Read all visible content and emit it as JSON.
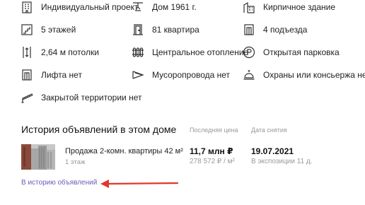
{
  "features": {
    "individual_project": {
      "label": "Индивидуальный проект",
      "icon": "building-icon"
    },
    "year": {
      "label": "Дом 1961 г.",
      "icon": "crane-icon"
    },
    "material": {
      "label": "Кирпичное здание",
      "icon": "brick-building-icon"
    },
    "floors": {
      "label": "5 этажей",
      "icon": "stairs-icon"
    },
    "flats": {
      "label": "81 квартира",
      "icon": "door-icon"
    },
    "entrances": {
      "label": "4 подъезда",
      "icon": "entrance-icon"
    },
    "ceilings": {
      "label": "2,64 м потолки",
      "icon": "ceiling-height-icon"
    },
    "heating": {
      "label": "Центральное отопление",
      "icon": "radiator-icon"
    },
    "parking": {
      "label": "Открытая парковка",
      "icon": "parking-icon"
    },
    "lift": {
      "label": "Лифта нет",
      "icon": "elevator-icon"
    },
    "garbage": {
      "label": "Мусоропровода нет",
      "icon": "garbage-chute-icon"
    },
    "concierge": {
      "label": "Охраны или консьержа нет",
      "icon": "concierge-bell-icon"
    },
    "closed_territory": {
      "label": "Закрытой территории нет",
      "icon": "barrier-icon"
    }
  },
  "history": {
    "title": "История объявлений в этом доме",
    "col_price": "Последняя цена",
    "col_date": "Дата снятия",
    "rows": [
      {
        "title": "Продажа 2-комн. квартиры 42 м²",
        "subtitle": "1 этаж",
        "price": "11,7 млн ₽",
        "price_per_m": "278 572 ₽ / м²",
        "date": "19.07.2021",
        "exposure": "В экспозиции 11 д."
      }
    ],
    "link": "В историю объявлений"
  },
  "colors": {
    "link": "#6b5bbd",
    "arrow": "#e0382e",
    "muted": "#999999"
  }
}
